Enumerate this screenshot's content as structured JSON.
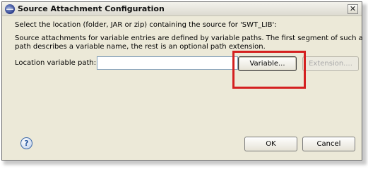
{
  "window": {
    "title": "Source Attachment Configuration",
    "close_glyph": "✕",
    "app_icon": "eclipse-icon"
  },
  "content": {
    "location_prompt": "Select the location (folder, JAR or zip) containing the source for 'SWT_LIB':",
    "description_line1": "Source attachments for variable entries are defined by variable paths. The first segment of such a",
    "description_line2": "path describes a variable name, the rest is an optional path extension.",
    "path_label": "Location variable path:",
    "path_value": ""
  },
  "buttons": {
    "variable": "Variable...",
    "extension": "Extension....",
    "ok": "OK",
    "cancel": "Cancel"
  },
  "help": {
    "glyph": "?",
    "icon": "help-icon"
  },
  "colors": {
    "dialog_bg": "#ece9d8",
    "highlight": "#d42020",
    "input_border": "#7f9db9"
  }
}
